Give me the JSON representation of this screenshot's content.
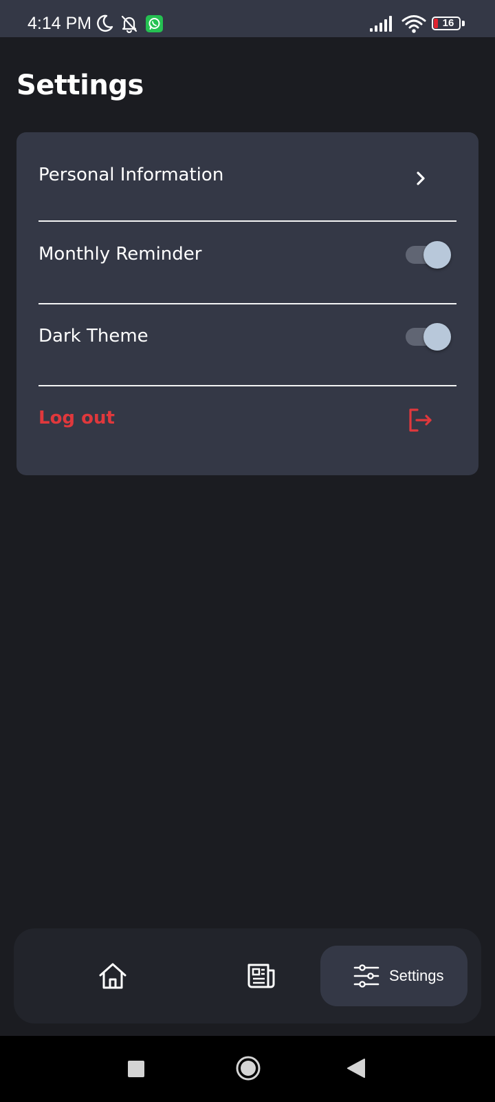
{
  "status_bar": {
    "time": "4:14 PM",
    "battery_level": "16",
    "icons": [
      "moon-icon",
      "bell-off-icon",
      "whatsapp-icon",
      "signal-icon",
      "wifi-icon",
      "battery-icon"
    ]
  },
  "page": {
    "title": "Settings"
  },
  "settings": {
    "items": [
      {
        "label": "Personal Information",
        "control": "chevron-right-icon"
      },
      {
        "label": "Monthly Reminder",
        "control": "toggle",
        "enabled": true
      },
      {
        "label": "Dark Theme",
        "control": "toggle",
        "enabled": true
      },
      {
        "label": "Log out",
        "control": "logout-icon",
        "color": "#e0383c"
      }
    ]
  },
  "bottom_nav": {
    "items": [
      {
        "icon": "home-icon",
        "label": ""
      },
      {
        "icon": "newspaper-icon",
        "label": ""
      },
      {
        "icon": "sliders-icon",
        "label": "Settings",
        "active": true
      }
    ]
  },
  "system_nav": {
    "icons": [
      "recents-icon",
      "home-circle-icon",
      "back-icon"
    ]
  },
  "colors": {
    "background": "#1b1c21",
    "card": "#343846",
    "nav_bar": "#22242b",
    "accent_danger": "#e0383c",
    "toggle_thumb": "#b8c8da",
    "toggle_track": "#606573"
  }
}
